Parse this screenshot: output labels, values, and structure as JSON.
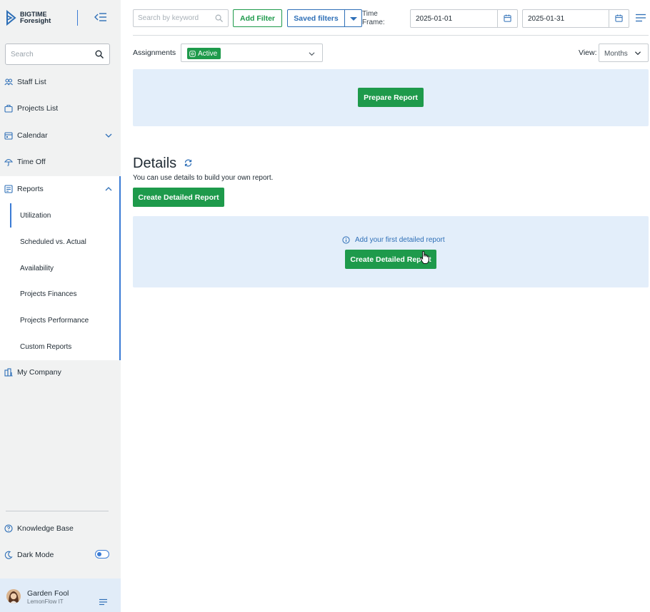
{
  "brand": {
    "line1": "BIGTIME",
    "line2": "Foresight"
  },
  "sidebar": {
    "search_placeholder": "Search",
    "nav": {
      "staff_list": "Staff List",
      "projects_list": "Projects List",
      "calendar": "Calendar",
      "time_off": "Time Off",
      "reports": "Reports",
      "my_company": "My Company"
    },
    "reports_sub": {
      "utilization": "Utilization",
      "scheduled_vs_actual": "Scheduled vs. Actual",
      "availability": "Availability",
      "projects_finances": "Projects Finances",
      "projects_performance": "Projects Performance",
      "custom_reports": "Custom Reports"
    },
    "knowledge_base": "Knowledge Base",
    "dark_mode": "Dark Mode",
    "dark_mode_on": true
  },
  "user": {
    "name": "Garden Fool",
    "org": "LemonFlow IT"
  },
  "toolbar": {
    "keyword_placeholder": "Search by keyword",
    "add_filter": "Add Filter",
    "saved_filters": "Saved filters",
    "time_frame_line1": "Time",
    "time_frame_line2": "Frame:",
    "date_from": "2025-01-01",
    "date_to": "2025-01-31"
  },
  "filters": {
    "assignments_label": "Assignments",
    "assignments_chip": "Active",
    "view_label": "View:",
    "view_value": "Months"
  },
  "prepare_report": "Prepare Report",
  "details": {
    "title": "Details",
    "subtitle": "You can use details to build your own report.",
    "create_button": "Create Detailed Report",
    "empty_hint": "Add your first detailed report",
    "empty_button": "Create Detailed Report"
  },
  "colors": {
    "accent_blue": "#2e6fb7",
    "primary_green": "#1e9a4b",
    "panel_bg": "#e3eefa",
    "sidebar_bg": "#f1f2f2"
  }
}
